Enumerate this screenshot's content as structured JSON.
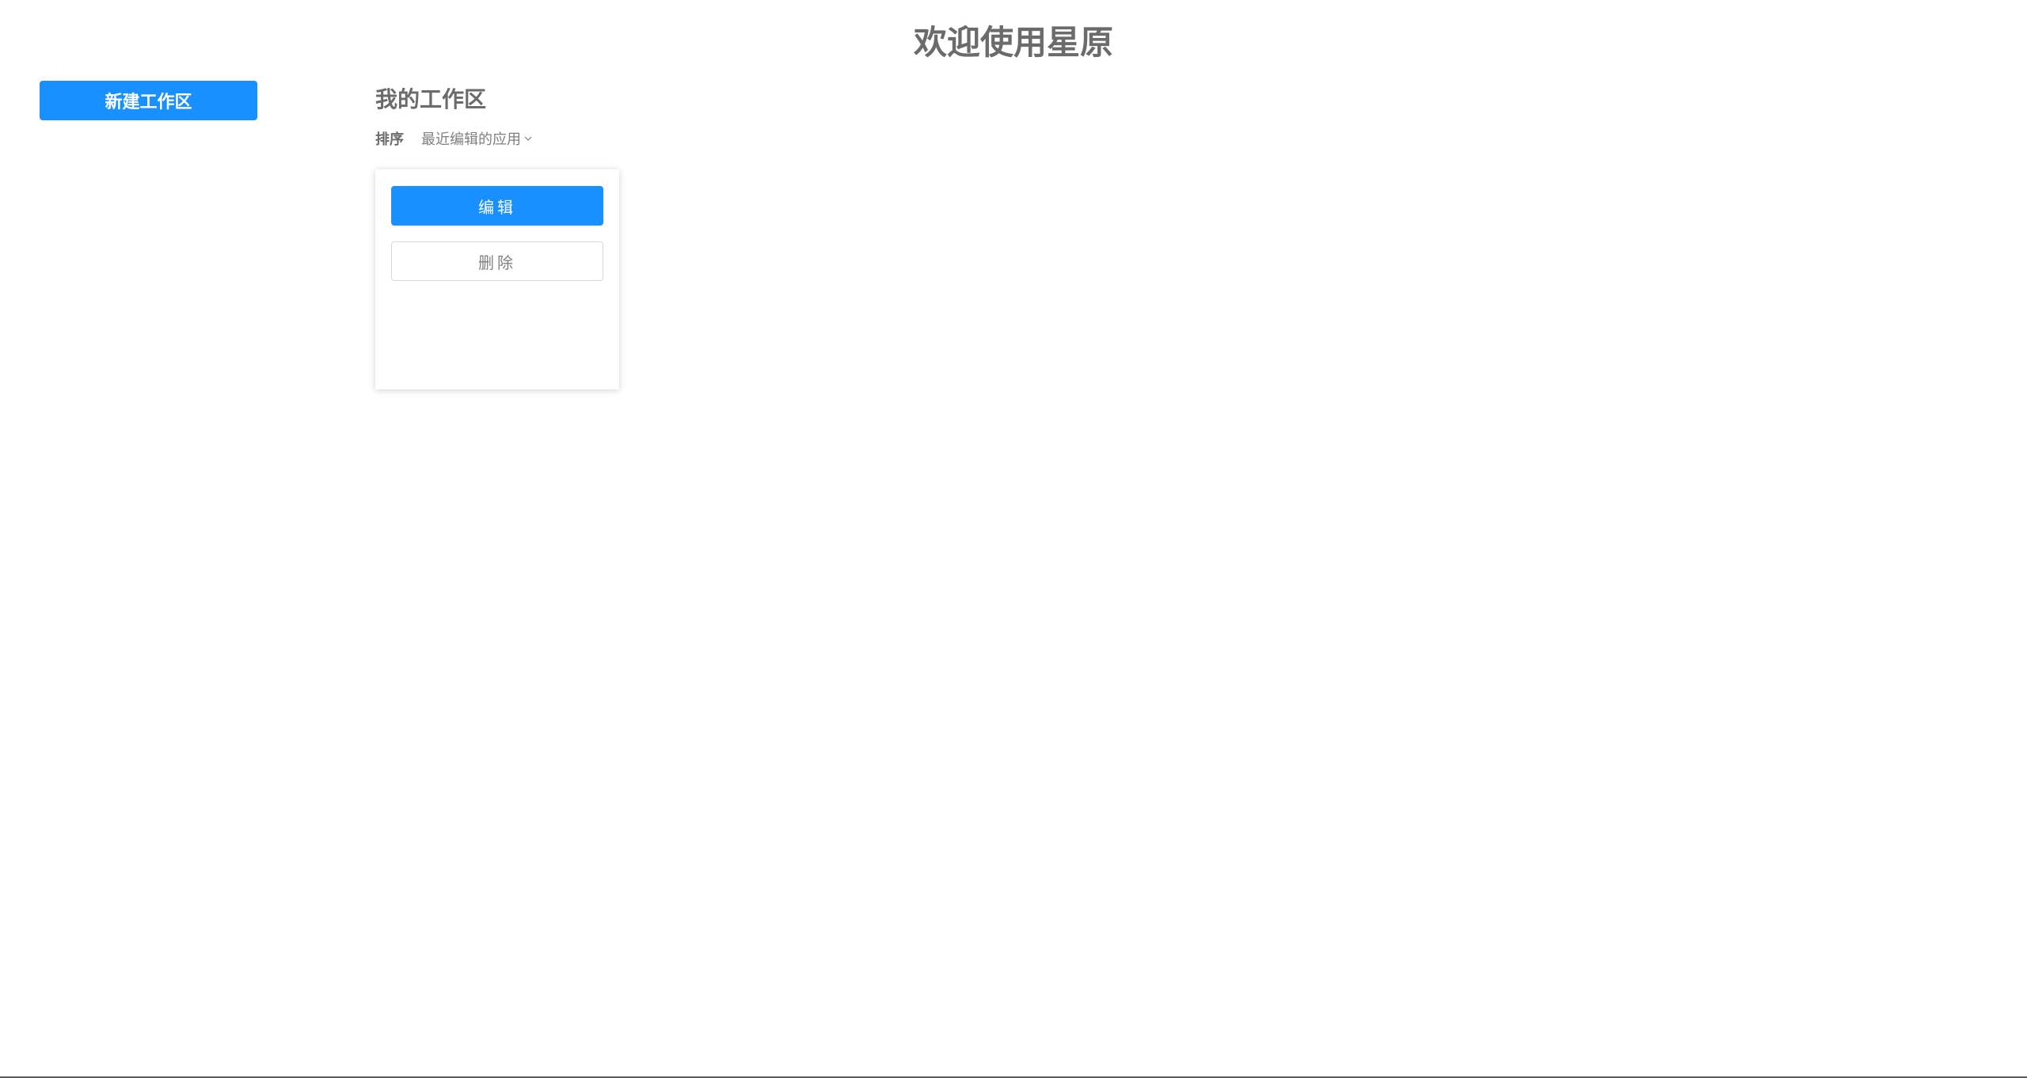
{
  "header": {
    "title": "欢迎使用星原"
  },
  "sidebar": {
    "new_workspace_label": "新建工作区"
  },
  "main": {
    "section_title": "我的工作区",
    "sort": {
      "label": "排序",
      "selected": "最近编辑的应用",
      "icon": "chevron-down-icon"
    },
    "workspaces": [
      {
        "edit_label": "编辑",
        "delete_label": "删除"
      }
    ]
  },
  "colors": {
    "primary": "#1890ff",
    "text": "#6b6b6b",
    "muted": "#808080",
    "border": "#d9d9d9"
  }
}
